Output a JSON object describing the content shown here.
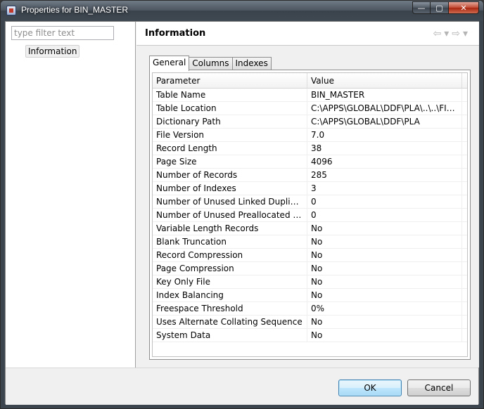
{
  "window": {
    "title": "Properties for BIN_MASTER",
    "controls": {
      "minimize": "—",
      "maximize": "▢",
      "close": "✕"
    }
  },
  "left_pane": {
    "filter_placeholder": "type filter text",
    "tree_items": [
      "Information"
    ]
  },
  "page": {
    "title": "Information",
    "nav_back": "⇦",
    "nav_back_menu": "▾",
    "nav_forward": "⇨",
    "nav_forward_menu": "▾"
  },
  "tabs": [
    {
      "label": "General",
      "active": true
    },
    {
      "label": "Columns",
      "active": false
    },
    {
      "label": "Indexes",
      "active": false
    }
  ],
  "table": {
    "headers": {
      "param": "Parameter",
      "value": "Value"
    },
    "rows": [
      [
        "Table Name",
        "BIN_MASTER"
      ],
      [
        "Table Location",
        "C:\\APPS\\GLOBAL\\DDF\\PLA\\..\\..\\FILE..."
      ],
      [
        "Dictionary Path",
        "C:\\APPS\\GLOBAL\\DDF\\PLA"
      ],
      [
        "File Version",
        "7.0"
      ],
      [
        "Record Length",
        "38"
      ],
      [
        "Page Size",
        "4096"
      ],
      [
        "Number of Records",
        "285"
      ],
      [
        "Number of Indexes",
        "3"
      ],
      [
        "Number of Unused Linked Duplicate ...",
        "0"
      ],
      [
        "Number of Unused Preallocated Pages",
        "0"
      ],
      [
        "Variable Length Records",
        "No"
      ],
      [
        "Blank Truncation",
        "No"
      ],
      [
        "Record Compression",
        "No"
      ],
      [
        "Page Compression",
        "No"
      ],
      [
        "Key Only File",
        "No"
      ],
      [
        "Index Balancing",
        "No"
      ],
      [
        "Freespace Threshold",
        "0%"
      ],
      [
        "Uses Alternate Collating Sequence",
        "No"
      ],
      [
        "System Data",
        "No"
      ]
    ]
  },
  "buttons": {
    "ok": "OK",
    "cancel": "Cancel"
  }
}
